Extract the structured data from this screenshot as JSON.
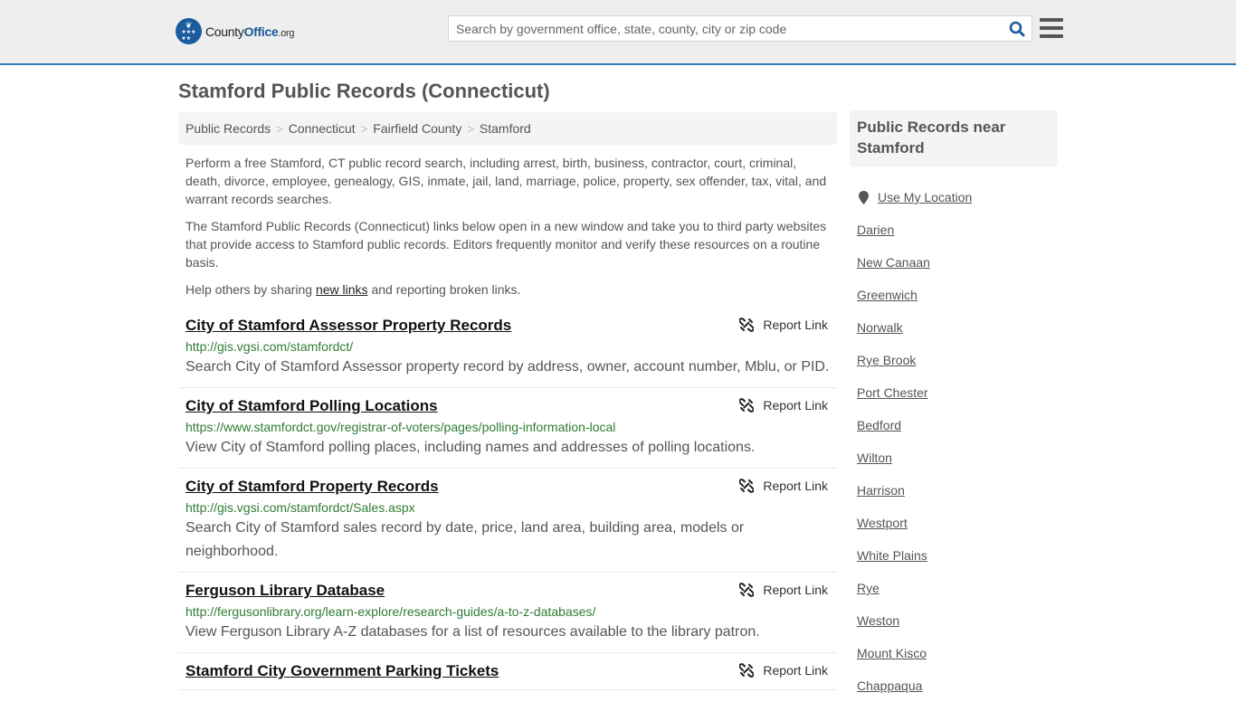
{
  "header": {
    "logo": {
      "brand_part1": "County",
      "brand_part2": "Office",
      "brand_suffix": ".org"
    },
    "search": {
      "placeholder": "Search by government office, state, county, city or zip code",
      "value": ""
    },
    "icons": {
      "search": "search-icon",
      "menu": "hamburger-menu-icon"
    }
  },
  "page": {
    "title": "Stamford Public Records (Connecticut)",
    "breadcrumb": [
      "Public Records",
      "Connecticut",
      "Fairfield County",
      "Stamford"
    ],
    "breadcrumb_separator": ">",
    "intro": {
      "p1": "Perform a free Stamford, CT public record search, including arrest, birth, business, contractor, court, criminal, death, divorce, employee, genealogy, GIS, inmate, jail, land, marriage, police, property, sex offender, tax, vital, and warrant records searches.",
      "p2": "The Stamford Public Records (Connecticut) links below open in a new window and take you to third party websites that provide access to Stamford public records. Editors frequently monitor and verify these resources on a routine basis.",
      "p3_before": "Help others by sharing ",
      "p3_link": "new links",
      "p3_after": " and reporting broken links."
    },
    "report_label": "Report Link",
    "results": [
      {
        "title": "City of Stamford Assessor Property Records",
        "url": "http://gis.vgsi.com/stamfordct/",
        "description": "Search City of Stamford Assessor property record by address, owner, account number, Mblu, or PID."
      },
      {
        "title": "City of Stamford Polling Locations",
        "url": "https://www.stamfordct.gov/registrar-of-voters/pages/polling-information-local",
        "description": "View City of Stamford polling places, including names and addresses of polling locations."
      },
      {
        "title": "City of Stamford Property Records",
        "url": "http://gis.vgsi.com/stamfordct/Sales.aspx",
        "description": "Search City of Stamford sales record by date, price, land area, building area, models or neighborhood."
      },
      {
        "title": "Ferguson Library Database",
        "url": "http://fergusonlibrary.org/learn-explore/research-guides/a-to-z-databases/",
        "description": "View Ferguson Library A-Z databases for a list of resources available to the library patron."
      },
      {
        "title": "Stamford City Government Parking Tickets",
        "url": "",
        "description": ""
      }
    ]
  },
  "sidebar": {
    "title": "Public Records near Stamford",
    "use_location": "Use My Location",
    "nearby": [
      "Darien",
      "New Canaan",
      "Greenwich",
      "Norwalk",
      "Rye Brook",
      "Port Chester",
      "Bedford",
      "Wilton",
      "Harrison",
      "Westport",
      "White Plains",
      "Rye",
      "Weston",
      "Mount Kisco",
      "Chappaqua"
    ]
  },
  "colors": {
    "brand_blue": "#1b5b9e",
    "header_border": "#337ab7",
    "url_green": "#2e7d32",
    "header_bg": "#eeeeee"
  }
}
